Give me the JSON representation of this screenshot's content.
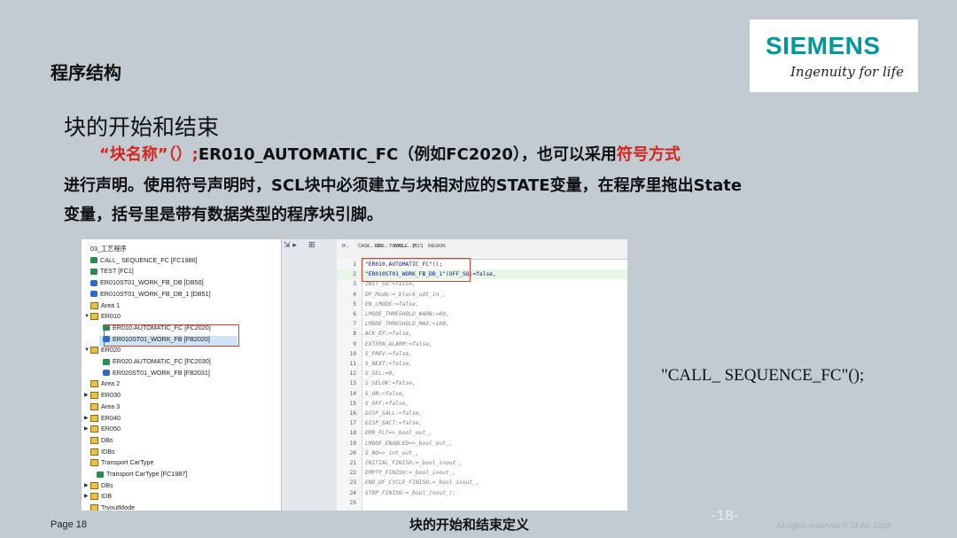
{
  "logo": {
    "word": "SIEMENS",
    "tagline": "Ingenuity for life"
  },
  "header": {
    "title": "程序结构"
  },
  "section": {
    "title": "块的开始和结束",
    "line1": {
      "quoted": "“块名称”（）;",
      "main": "ER010_AUTOMATIC_FC（例如FC2020），也可以采用",
      "red_tail": "符号方式"
    },
    "line2": "进行声明。使用符号声明时，SCL块中必须建立与块相对应的STATE变量，在程序里拖出State",
    "line3": "变量，括号里是带有数据类型的程序块引脚。"
  },
  "screenshot": {
    "tree_items": [
      {
        "label": "03_工艺程序",
        "icon": "none",
        "indent": 0,
        "arrow": ""
      },
      {
        "label": "CALL_ SEQUENCE_FC [FC1986]",
        "icon": "fc",
        "indent": 0,
        "arrow": ""
      },
      {
        "label": "TEST [FC1]",
        "icon": "fc",
        "indent": 0,
        "arrow": ""
      },
      {
        "label": "ER010ST01_WORK_FB_DB [DB50]",
        "icon": "db",
        "indent": 0,
        "arrow": ""
      },
      {
        "label": "ER010ST01_WORK_FB_DB_1 [DB51]",
        "icon": "db",
        "indent": 0,
        "arrow": ""
      },
      {
        "label": "Area 1",
        "icon": "grp",
        "indent": 0,
        "arrow": ""
      },
      {
        "label": "ER010",
        "icon": "grp",
        "indent": 0,
        "arrow": "▼"
      },
      {
        "label": "ER010.AUTOMATIC_FC [FC2020]",
        "icon": "fc",
        "indent": 2,
        "arrow": ""
      },
      {
        "label": "ER010ST01_WORK_FB [FB2020]",
        "icon": "db",
        "indent": 2,
        "arrow": ""
      },
      {
        "label": "ER020",
        "icon": "grp",
        "indent": 0,
        "arrow": "▼"
      },
      {
        "label": "ER020.AUTOMATIC_FC [FC2030]",
        "icon": "fc",
        "indent": 2,
        "arrow": ""
      },
      {
        "label": "ER020ST01_WORK_FB [FB2031]",
        "icon": "db",
        "indent": 2,
        "arrow": ""
      },
      {
        "label": "Area 2",
        "icon": "grp",
        "indent": 0,
        "arrow": ""
      },
      {
        "label": "ER030",
        "icon": "grp",
        "indent": 0,
        "arrow": "▶"
      },
      {
        "label": "Area 3",
        "icon": "grp",
        "indent": 0,
        "arrow": ""
      },
      {
        "label": "ER040",
        "icon": "grp",
        "indent": 0,
        "arrow": "▶"
      },
      {
        "label": "ER050",
        "icon": "grp",
        "indent": 0,
        "arrow": "▶"
      },
      {
        "label": "DBs",
        "icon": "grp",
        "indent": 0,
        "arrow": ""
      },
      {
        "label": "IDBs",
        "icon": "grp",
        "indent": 0,
        "arrow": ""
      },
      {
        "label": "Transport CarType",
        "icon": "grp",
        "indent": 0,
        "arrow": ""
      },
      {
        "label": "Transport CarType [FC1987]",
        "icon": "fc",
        "indent": 1,
        "arrow": ""
      },
      {
        "label": "DBs",
        "icon": "grp",
        "indent": 0,
        "arrow": "▶"
      },
      {
        "label": "IDB",
        "icon": "grp",
        "indent": 0,
        "arrow": "▶"
      },
      {
        "label": "TryoutMode",
        "icon": "grp",
        "indent": 0,
        "arrow": ""
      }
    ],
    "toolbar": [
      "IF...",
      "CASE... OF...",
      "FOR... TO DO...",
      "WHILE... DO...",
      "(*...*)",
      "REGION"
    ],
    "code_lines": [
      {
        "n": "1",
        "text": "\"ER010.AUTOMATIC_FC\"();"
      },
      {
        "n": "2",
        "text": "\"ER010ST01_WORK_FB_DB_1\"(OFF_SQ:=false,"
      },
      {
        "n": "3",
        "text": "INIT_SQ:=false,"
      },
      {
        "n": "4",
        "text": "OP_Mode:=_block_udt_in_,"
      },
      {
        "n": "5",
        "text": "EN_LMODE:=false,"
      },
      {
        "n": "6",
        "text": "LMODE_THRESHOLD_WARN:=80,"
      },
      {
        "n": "7",
        "text": "LMODE_THRESHOLD_MAX:=100,"
      },
      {
        "n": "8",
        "text": "ACK_EF:=false,"
      },
      {
        "n": "9",
        "text": "EXTERN_ALARM:=false,"
      },
      {
        "n": "10",
        "text": "S_PREV:=false,"
      },
      {
        "n": "11",
        "text": "S_NEXT:=false,"
      },
      {
        "n": "12",
        "text": "S_SEL:=0,"
      },
      {
        "n": "13",
        "text": "S_SELOK:=false,"
      },
      {
        "n": "14",
        "text": "S_ON:=false,"
      },
      {
        "n": "15",
        "text": "S_OFF:=false,"
      },
      {
        "n": "16",
        "text": "DISP_SALL:=false,"
      },
      {
        "n": "17",
        "text": "DISP_SACT:=false,"
      },
      {
        "n": "18",
        "text": "ERR_FLT=>_bool_out_,"
      },
      {
        "n": "19",
        "text": "LMODE_ENABLED=>_bool_out_,"
      },
      {
        "n": "20",
        "text": "S_NO=>_int_out_,"
      },
      {
        "n": "21",
        "text": "INITIAL_FINISH:=_bool_inout_,"
      },
      {
        "n": "22",
        "text": "EMPTY_FINISH:=_bool_inout_,"
      },
      {
        "n": "23",
        "text": "END_OF_CYCLE_FINISH:=_bool_inout_,"
      },
      {
        "n": "24",
        "text": "STOP_FINISH:=_bool_inout_);"
      },
      {
        "n": "25",
        "text": ""
      }
    ]
  },
  "call_example": "\"CALL_ SEQUENCE_FC\"();",
  "footer": {
    "page": "Page 18",
    "title": "块的开始和结束定义",
    "slide_num": "-18-",
    "rights": "All rights reserved © SFAE 2018"
  },
  "colors": {
    "accent": "#009999",
    "red": "#d4251e",
    "background": "#c2cad2"
  }
}
